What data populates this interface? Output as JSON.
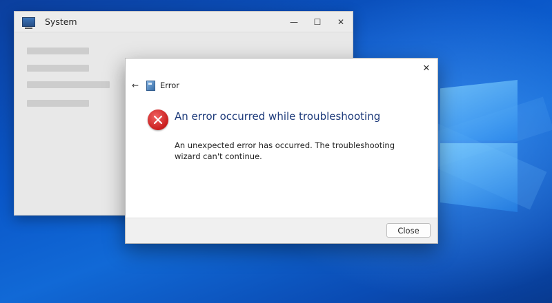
{
  "background_window": {
    "title": "System",
    "icon": "monitor-icon",
    "controls": {
      "minimize_glyph": "—",
      "maximize_glyph": "☐",
      "close_glyph": "✕"
    }
  },
  "dialog": {
    "close_glyph": "✕",
    "back_glyph": "←",
    "header_icon": "troubleshooter-icon",
    "header_title": "Error",
    "error_icon": "error-x-icon",
    "headline": "An error occurred while troubleshooting",
    "message": "An unexpected error has occurred. The troubleshooting wizard can't continue.",
    "close_button_label": "Close"
  },
  "colors": {
    "headline": "#1d3a7a",
    "error_red": "#c81e1e",
    "desktop_blue": "#0a57c9"
  }
}
